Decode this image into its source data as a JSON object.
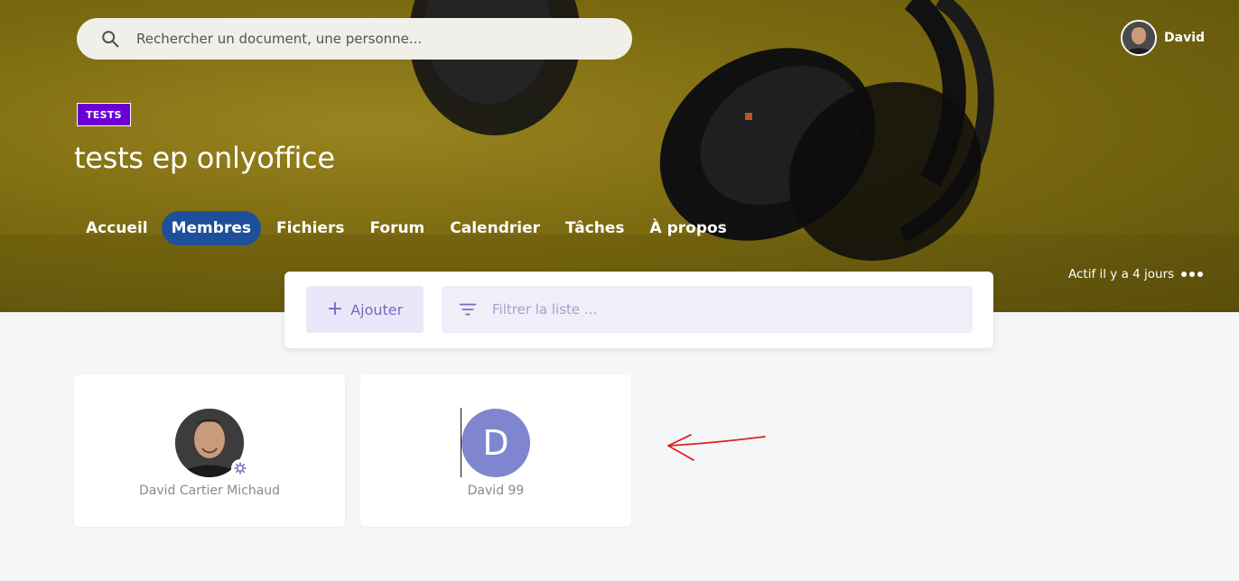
{
  "header": {
    "search": {
      "placeholder": "Rechercher un document, une personne..."
    },
    "user": {
      "name": "David"
    }
  },
  "space": {
    "tag": "TESTS",
    "title": "tests ep onlyoffice",
    "activity": "Actif il y a 4 jours"
  },
  "tabs": [
    {
      "label": "Accueil",
      "active": false
    },
    {
      "label": "Membres",
      "active": true
    },
    {
      "label": "Fichiers",
      "active": false
    },
    {
      "label": "Forum",
      "active": false
    },
    {
      "label": "Calendrier",
      "active": false
    },
    {
      "label": "Tâches",
      "active": false
    },
    {
      "label": "À propos",
      "active": false
    }
  ],
  "toolbar": {
    "add_label": "Ajouter",
    "filter_placeholder": "Filtrer la liste ..."
  },
  "members": [
    {
      "name": "David Cartier Michaud",
      "avatar": "photo",
      "admin_icon": "gear-icon"
    },
    {
      "name": "David 99",
      "avatar": "letter",
      "initial": "D"
    }
  ],
  "colors": {
    "active_tab": "#1e4f9a",
    "tag_badge": "#6a00d4",
    "letter_avatar": "#7f86cf",
    "accent_purple": "#7a68c2",
    "annotation_arrow": "#e02020"
  }
}
